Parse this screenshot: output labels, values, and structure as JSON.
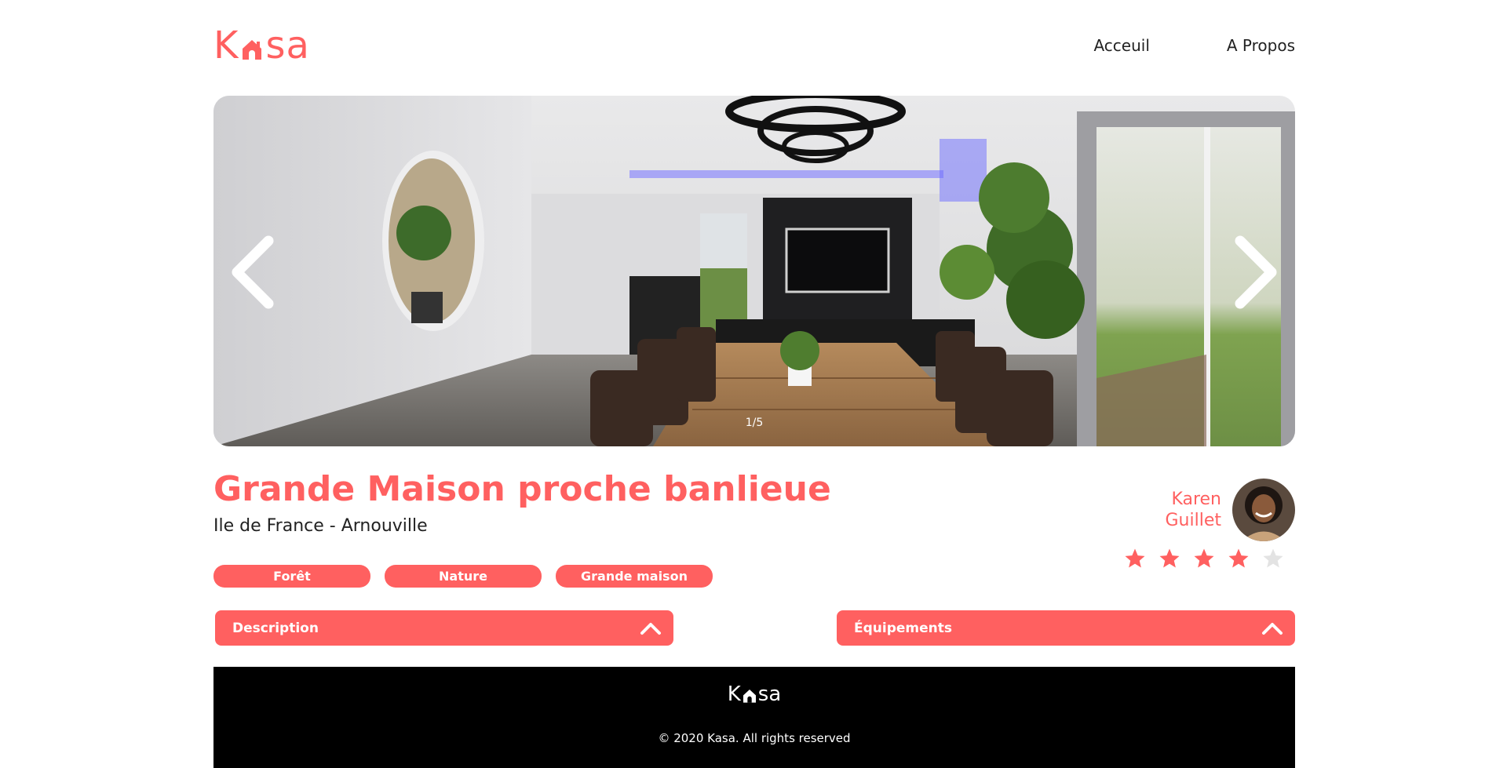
{
  "header": {
    "logo_left": "K",
    "logo_right": "sa",
    "nav": [
      {
        "label": "Acceuil"
      },
      {
        "label": "A Propos"
      }
    ]
  },
  "carousel": {
    "counter": "1/5",
    "icons": {
      "prev": "chevron-left-icon",
      "next": "chevron-right-icon"
    }
  },
  "listing": {
    "title": "Grande Maison proche banlieue",
    "location": "Ile de France - Arnouville",
    "tags": [
      "Forêt",
      "Nature",
      "Grande maison"
    ],
    "host": {
      "first_name": "Karen",
      "last_name": "Guillet"
    },
    "rating": 4,
    "rating_max": 5
  },
  "collapses": [
    {
      "label": "Description"
    },
    {
      "label": "Équipements"
    }
  ],
  "footer": {
    "logo_left": "K",
    "logo_right": "sa",
    "copyright": "© 2020 Kasa. All rights reserved"
  },
  "colors": {
    "brand": "#FF6060",
    "star_off": "#E3E3E3",
    "footer_bg": "#000000"
  }
}
